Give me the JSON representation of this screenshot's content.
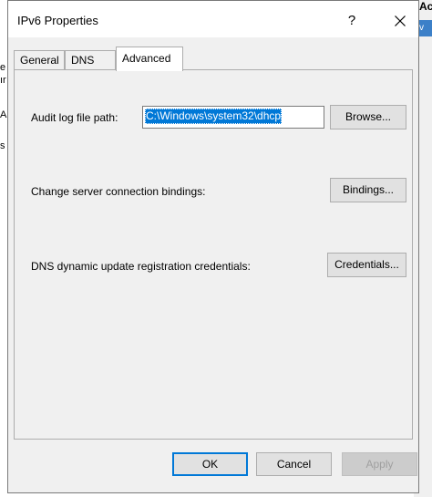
{
  "background": {
    "left_fragments": [
      "e",
      "ır",
      "A",
      "s"
    ],
    "right_title": "Act",
    "right_strip": "v"
  },
  "dialog": {
    "title": "IPv6 Properties",
    "help_glyph": "?",
    "tabs": [
      {
        "label": "General",
        "active": false
      },
      {
        "label": "DNS",
        "active": false
      },
      {
        "label": "Advanced",
        "active": true
      }
    ],
    "audit": {
      "label": "Audit log file path:",
      "value": "C:\\Windows\\system32\\dhcp",
      "button": "Browse..."
    },
    "bindings": {
      "label": "Change server connection bindings:",
      "button": "Bindings..."
    },
    "credentials": {
      "label": "DNS dynamic update registration credentials:",
      "button": "Credentials..."
    },
    "footer": {
      "ok": "OK",
      "cancel": "Cancel",
      "apply": "Apply"
    }
  },
  "icons": {
    "close": "close-icon"
  },
  "colors": {
    "selection": "#0078d7",
    "dialog_bg": "#f0f0f0"
  }
}
